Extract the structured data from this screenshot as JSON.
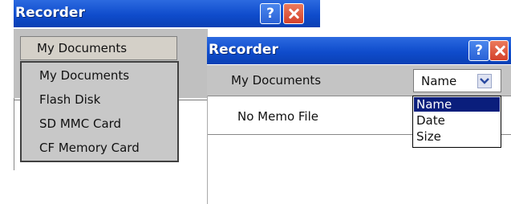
{
  "window_back": {
    "title": "Recorder",
    "location_combo_value": "My Documents",
    "location_options": [
      "My Documents",
      "Flash Disk",
      "SD MMC Card",
      "CF Memory Card"
    ]
  },
  "window_front": {
    "title": "Recorder",
    "location_label": "My Documents",
    "sort_select_value": "Name",
    "sort_options": [
      "Name",
      "Date",
      "Size"
    ],
    "selected_sort_option": "Name",
    "empty_message": "No Memo File"
  },
  "titlebar_buttons": {
    "help_label": "?"
  },
  "colors": {
    "titlebar": "#0f4ccc",
    "close_button": "#d4412b",
    "selection": "#0a1e7c"
  }
}
